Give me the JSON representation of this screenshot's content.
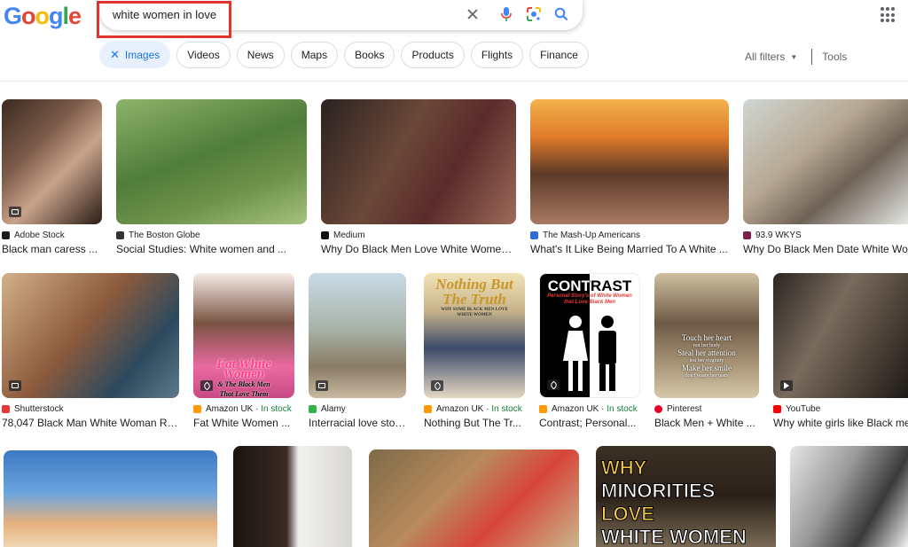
{
  "search": {
    "query": "white women in love"
  },
  "logo": {
    "letters": [
      "G",
      "o",
      "o",
      "g",
      "l",
      "e"
    ],
    "colors": [
      "#4285F4",
      "#EA4335",
      "#FBBC05",
      "#4285F4",
      "#34A853",
      "#EA4335"
    ]
  },
  "chips": [
    {
      "label": "Images",
      "active": true
    },
    {
      "label": "Videos"
    },
    {
      "label": "News"
    },
    {
      "label": "Maps"
    },
    {
      "label": "Books"
    },
    {
      "label": "Products"
    },
    {
      "label": "Flights"
    },
    {
      "label": "Finance"
    }
  ],
  "filters": {
    "all_filters": "All filters",
    "tools": "Tools"
  },
  "results": [
    {
      "source": "Adobe Stock",
      "title": "Black man caress ...",
      "favicon": "#1d1d1d",
      "badge": "image"
    },
    {
      "source": "The Boston Globe",
      "title": "Social Studies: White women and ...",
      "favicon": "#333333"
    },
    {
      "source": "Medium",
      "title": "Why Do Black Men Love White Women ...",
      "favicon": "#111111"
    },
    {
      "source": "The Mash-Up Americans",
      "title": "What's It Like Being Married To A White ...",
      "favicon": "#2f6cd8"
    },
    {
      "source": "93.9 WKYS",
      "title": "Why Do Black Men Date White Women",
      "favicon": "#7a1f4a"
    },
    {
      "source": "Shutterstock",
      "title": "78,047 Black Man White Woman Ro...",
      "favicon": "#e53935",
      "badge": "image"
    },
    {
      "source": "Amazon UK",
      "stock": "In stock",
      "title": "Fat White Women ...",
      "favicon": "#ff9900",
      "badge": "tag",
      "overlay": [
        "Fat White Women",
        "& The Black Men",
        "That Love Them"
      ]
    },
    {
      "source": "Alamy",
      "title": "Interracial love stor...",
      "favicon": "#2fb34a",
      "badge": "image"
    },
    {
      "source": "Amazon UK",
      "stock": "In stock",
      "title": "Nothing But The Tr...",
      "favicon": "#ff9900",
      "badge": "tag",
      "overlay": [
        "Nothing But",
        "The Truth",
        "WHY SOME BLACK MEN LOVE",
        "WHITE WOMEN"
      ]
    },
    {
      "source": "Amazon UK",
      "stock": "In stock",
      "title": "Contrast; Personal...",
      "favicon": "#ff9900",
      "badge": "tag",
      "overlay": [
        "CONTRAST",
        "Personal Story's of White Women that Love Black Men"
      ]
    },
    {
      "source": "Pinterest",
      "title": "Black Men + White ...",
      "favicon": "#e60023",
      "overlay": [
        "Touch her heart",
        "not her body",
        "Steal her attention",
        "not her virginity",
        "Make her smile",
        "don't waste her tears"
      ]
    },
    {
      "source": "YouTube",
      "title": "Why white girls like Black men",
      "favicon": "#ff0000",
      "badge": "play"
    },
    {
      "source": "",
      "title": ""
    },
    {
      "source": "",
      "title": ""
    },
    {
      "source": "",
      "title": ""
    },
    {
      "source": "",
      "title": "",
      "overlay": [
        "WHY",
        "MINORITIES",
        "LOVE",
        "WHITE WOMEN"
      ]
    },
    {
      "source": "",
      "title": ""
    }
  ]
}
